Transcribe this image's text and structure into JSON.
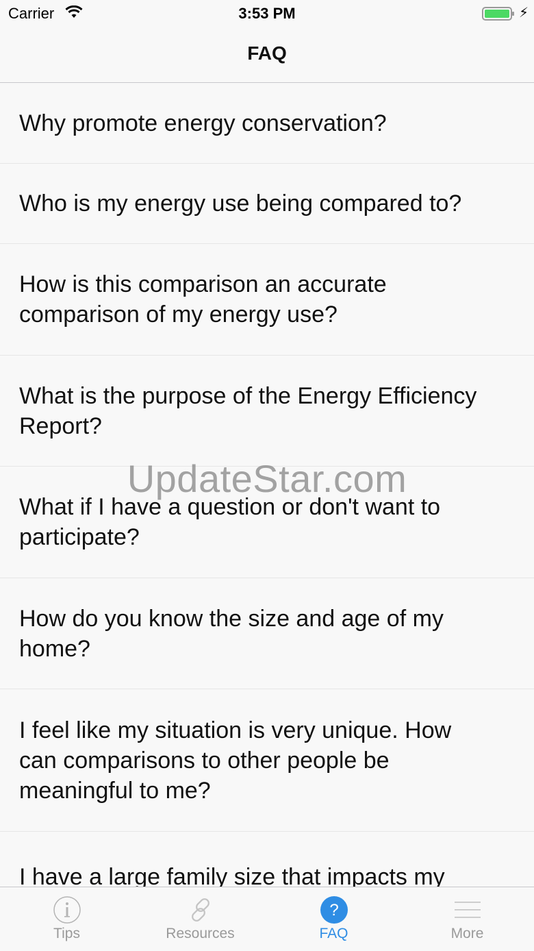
{
  "status_bar": {
    "carrier": "Carrier",
    "time": "3:53 PM"
  },
  "nav": {
    "title": "FAQ"
  },
  "faq": {
    "items": [
      "Why promote energy conservation?",
      "Who is my energy use being compared to?",
      "How is this comparison an accurate comparison of my energy use?",
      "What is the purpose of the Energy Efficiency Report?",
      "What if I have a question or don't want to participate?",
      "How do you know the size and age of my home?",
      "I feel like my situation is very unique. How can comparisons to other people be meaningful to me?",
      "I have a large family size that impacts my"
    ]
  },
  "watermark": "UpdateStar.com",
  "tabs": [
    {
      "label": "Tips",
      "icon": "info-icon"
    },
    {
      "label": "Resources",
      "icon": "link-icon"
    },
    {
      "label": "FAQ",
      "icon": "question-icon"
    },
    {
      "label": "More",
      "icon": "menu-icon"
    }
  ],
  "colors": {
    "accent": "#2f8de4",
    "inactive": "#9a9a9a",
    "battery": "#4cd964"
  }
}
